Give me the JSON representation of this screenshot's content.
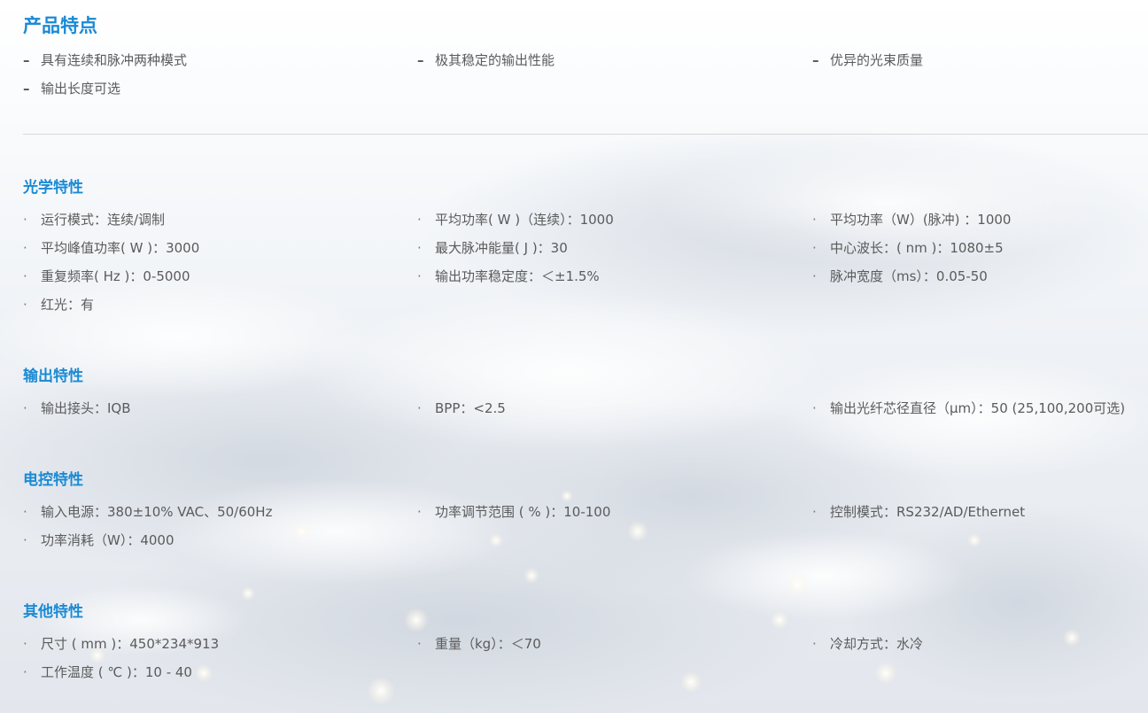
{
  "features": {
    "title": "产品特点",
    "items": [
      "具有连续和脉冲两种模式",
      "极其稳定的输出性能",
      "优异的光束质量",
      "输出长度可选"
    ]
  },
  "optical": {
    "title": "光学特性",
    "items": [
      "运行模式：连续/调制",
      "平均功率( W )（连续）：1000",
      "平均功率（W）(脉冲) ：1000",
      "平均峰值功率( W )：3000",
      "最大脉冲能量( J )：30",
      "中心波长：( nm )：1080±5",
      "重复频率( Hz )：0-5000",
      "输出功率稳定度：＜±1.5%",
      "脉冲宽度（ms）：0.05-50",
      "红光：有"
    ]
  },
  "output": {
    "title": "输出特性",
    "items": [
      "输出接头：IQB",
      "BPP：<2.5",
      "输出光纤芯径直径（μm）：50 (25,100,200可选)"
    ]
  },
  "electrical": {
    "title": "电控特性",
    "items": [
      "输入电源：380±10% VAC、50/60Hz",
      "功率调节范围 ( % )：10-100",
      "控制模式：RS232/AD/Ethernet",
      "功率消耗（W）：4000"
    ]
  },
  "other": {
    "title": "其他特性",
    "items": [
      "尺寸 ( mm )：450*234*913",
      "重量（kg）：＜70",
      "冷却方式：水冷",
      "工作温度 ( ℃ )：10 - 40"
    ]
  },
  "bullet_symbols": {
    "dash": "–",
    "dot": "·"
  },
  "colors": {
    "heading": "#1a8ad4",
    "text": "#5b5b5b",
    "divider": "#d8d8d8"
  }
}
